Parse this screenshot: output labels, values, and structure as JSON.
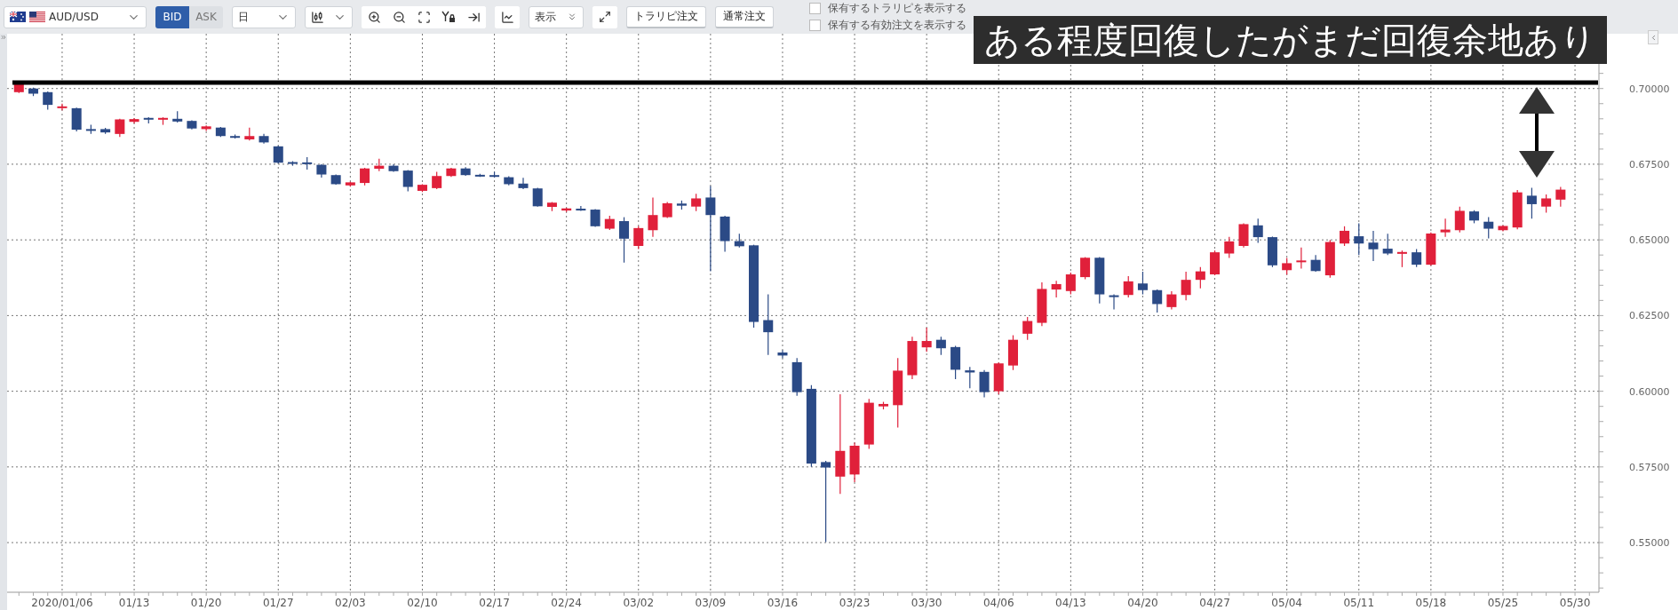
{
  "toolbar": {
    "symbol": {
      "label": "AUD/USD"
    },
    "price_side": [
      {
        "label": "BID",
        "selected": true
      },
      {
        "label": "ASK",
        "selected": false
      }
    ],
    "timeframe": {
      "value": "日"
    },
    "view_menu": {
      "label": "表示"
    },
    "order_buttons": [
      "トラリピ注文",
      "通常注文"
    ],
    "options": [
      {
        "label": "保有するトラリピを表示する",
        "checked": false
      },
      {
        "label": "保有する有効注文を表示する",
        "checked": false
      }
    ]
  },
  "chart": {
    "caption": "ある程度回復したがまだ回復余地あり",
    "chart_data": {
      "type": "candlestick",
      "categories": [
        null,
        null,
        null,
        "2020/01/06",
        null,
        null,
        null,
        null,
        "01/13",
        null,
        null,
        null,
        null,
        "01/20",
        null,
        null,
        null,
        null,
        "01/27",
        null,
        null,
        null,
        null,
        "02/03",
        null,
        null,
        null,
        null,
        "02/10",
        null,
        null,
        null,
        null,
        "02/17",
        null,
        null,
        null,
        null,
        "02/24",
        null,
        null,
        null,
        null,
        "03/02",
        null,
        null,
        null,
        null,
        "03/09",
        null,
        null,
        null,
        null,
        "03/16",
        null,
        null,
        null,
        null,
        "03/23",
        null,
        null,
        null,
        null,
        "03/30",
        null,
        null,
        null,
        null,
        "04/06",
        null,
        null,
        null,
        null,
        "04/13",
        null,
        null,
        null,
        null,
        "04/20",
        null,
        null,
        null,
        null,
        "04/27",
        null,
        null,
        null,
        null,
        "05/04",
        null,
        null,
        null,
        null,
        "05/11",
        null,
        null,
        null,
        null,
        "05/18",
        null,
        null,
        null,
        null,
        "05/25",
        null,
        null,
        null,
        null,
        "05/30"
      ],
      "ohlc": [
        [
          0.6988,
          0.702,
          0.6985,
          0.7015
        ],
        [
          0.7,
          0.7003,
          0.6975,
          0.6983
        ],
        [
          0.6988,
          0.699,
          0.693,
          0.6946
        ],
        [
          0.6937,
          0.695,
          0.6928,
          0.6941
        ],
        [
          0.6935,
          0.6937,
          0.6858,
          0.6864
        ],
        [
          0.6866,
          0.688,
          0.685,
          0.6862
        ],
        [
          0.6866,
          0.687,
          0.685,
          0.6855
        ],
        [
          0.685,
          0.69,
          0.684,
          0.6898
        ],
        [
          0.689,
          0.6902,
          0.6885,
          0.6899
        ],
        [
          0.6903,
          0.6905,
          0.6885,
          0.69
        ],
        [
          0.6897,
          0.6905,
          0.688,
          0.6903
        ],
        [
          0.69,
          0.6925,
          0.6888,
          0.6891
        ],
        [
          0.6893,
          0.6895,
          0.6865,
          0.6868
        ],
        [
          0.6866,
          0.6878,
          0.686,
          0.6875
        ],
        [
          0.6871,
          0.6873,
          0.684,
          0.6843
        ],
        [
          0.6843,
          0.6848,
          0.6835,
          0.684
        ],
        [
          0.6832,
          0.6871,
          0.6828,
          0.6843
        ],
        [
          0.6843,
          0.685,
          0.6818,
          0.6822
        ],
        [
          0.6809,
          0.6811,
          0.6753,
          0.6755
        ],
        [
          0.6757,
          0.676,
          0.6745,
          0.6755
        ],
        [
          0.6756,
          0.6773,
          0.6732,
          0.6751
        ],
        [
          0.6748,
          0.675,
          0.6706,
          0.6716
        ],
        [
          0.6714,
          0.6716,
          0.6682,
          0.6684
        ],
        [
          0.668,
          0.6692,
          0.6676,
          0.669
        ],
        [
          0.6688,
          0.6738,
          0.668,
          0.6736
        ],
        [
          0.6735,
          0.6768,
          0.6727,
          0.6745
        ],
        [
          0.6745,
          0.675,
          0.6725,
          0.6727
        ],
        [
          0.6729,
          0.6731,
          0.666,
          0.6675
        ],
        [
          0.6662,
          0.6684,
          0.6658,
          0.6682
        ],
        [
          0.6671,
          0.6725,
          0.6668,
          0.6711
        ],
        [
          0.6711,
          0.6738,
          0.6708,
          0.6736
        ],
        [
          0.6736,
          0.674,
          0.6712,
          0.6714
        ],
        [
          0.6715,
          0.6718,
          0.6708,
          0.6712
        ],
        [
          0.6714,
          0.6725,
          0.6706,
          0.6711
        ],
        [
          0.6707,
          0.671,
          0.668,
          0.6684
        ],
        [
          0.6686,
          0.6705,
          0.6668,
          0.6671
        ],
        [
          0.667,
          0.6672,
          0.661,
          0.6611
        ],
        [
          0.6609,
          0.6625,
          0.6595,
          0.6623
        ],
        [
          0.6597,
          0.6606,
          0.6592,
          0.6604
        ],
        [
          0.6603,
          0.6612,
          0.6596,
          0.6598
        ],
        [
          0.66,
          0.6602,
          0.6543,
          0.6545
        ],
        [
          0.6537,
          0.658,
          0.6533,
          0.6569
        ],
        [
          0.6562,
          0.6575,
          0.6425,
          0.6504
        ],
        [
          0.648,
          0.6545,
          0.647,
          0.6539
        ],
        [
          0.6532,
          0.664,
          0.651,
          0.6582
        ],
        [
          0.6575,
          0.6625,
          0.6572,
          0.6621
        ],
        [
          0.662,
          0.663,
          0.66,
          0.6613
        ],
        [
          0.661,
          0.6652,
          0.6595,
          0.6637
        ],
        [
          0.664,
          0.6678,
          0.6396,
          0.6582
        ],
        [
          0.6577,
          0.658,
          0.6461,
          0.6496
        ],
        [
          0.6496,
          0.652,
          0.6475,
          0.6479
        ],
        [
          0.6482,
          0.6484,
          0.621,
          0.6229
        ],
        [
          0.6235,
          0.632,
          0.612,
          0.6195
        ],
        [
          0.6128,
          0.6135,
          0.611,
          0.6118
        ],
        [
          0.6096,
          0.611,
          0.5985,
          0.5997
        ],
        [
          0.6008,
          0.602,
          0.575,
          0.5761
        ],
        [
          0.5766,
          0.577,
          0.5502,
          0.5748
        ],
        [
          0.5718,
          0.599,
          0.5661,
          0.5803
        ],
        [
          0.5725,
          0.583,
          0.57,
          0.582
        ],
        [
          0.5824,
          0.5975,
          0.581,
          0.5962
        ],
        [
          0.595,
          0.5965,
          0.594,
          0.5958
        ],
        [
          0.5954,
          0.611,
          0.588,
          0.6068
        ],
        [
          0.6053,
          0.618,
          0.604,
          0.6166
        ],
        [
          0.6145,
          0.621,
          0.613,
          0.6166
        ],
        [
          0.617,
          0.618,
          0.612,
          0.6142
        ],
        [
          0.6146,
          0.615,
          0.604,
          0.6071
        ],
        [
          0.6069,
          0.608,
          0.601,
          0.6062
        ],
        [
          0.6064,
          0.607,
          0.598,
          0.5997
        ],
        [
          0.6,
          0.6095,
          0.599,
          0.6092
        ],
        [
          0.6085,
          0.6185,
          0.607,
          0.617
        ],
        [
          0.619,
          0.6245,
          0.617,
          0.6232
        ],
        [
          0.6226,
          0.636,
          0.6215,
          0.6338
        ],
        [
          0.6336,
          0.6365,
          0.631,
          0.6354
        ],
        [
          0.6331,
          0.6392,
          0.632,
          0.6386
        ],
        [
          0.6377,
          0.6443,
          0.637,
          0.6441
        ],
        [
          0.6441,
          0.6443,
          0.629,
          0.632
        ],
        [
          0.6317,
          0.632,
          0.627,
          0.6311
        ],
        [
          0.6318,
          0.638,
          0.631,
          0.6363
        ],
        [
          0.6356,
          0.6395,
          0.632,
          0.6334
        ],
        [
          0.6334,
          0.6336,
          0.626,
          0.6288
        ],
        [
          0.6278,
          0.633,
          0.627,
          0.632
        ],
        [
          0.6318,
          0.6395,
          0.63,
          0.6368
        ],
        [
          0.6368,
          0.641,
          0.634,
          0.6396
        ],
        [
          0.6386,
          0.6465,
          0.6383,
          0.6459
        ],
        [
          0.6455,
          0.651,
          0.644,
          0.6495
        ],
        [
          0.648,
          0.6555,
          0.6475,
          0.6552
        ],
        [
          0.6548,
          0.657,
          0.649,
          0.6509
        ],
        [
          0.6509,
          0.6511,
          0.641,
          0.6416
        ],
        [
          0.64,
          0.644,
          0.6385,
          0.6423
        ],
        [
          0.6427,
          0.6475,
          0.6405,
          0.6432
        ],
        [
          0.6434,
          0.645,
          0.6395,
          0.6397
        ],
        [
          0.6383,
          0.65,
          0.6375,
          0.6493
        ],
        [
          0.6488,
          0.6545,
          0.648,
          0.653
        ],
        [
          0.6512,
          0.6555,
          0.645,
          0.6488
        ],
        [
          0.6491,
          0.653,
          0.643,
          0.6469
        ],
        [
          0.6471,
          0.652,
          0.645,
          0.6455
        ],
        [
          0.6454,
          0.6465,
          0.641,
          0.646
        ],
        [
          0.6459,
          0.647,
          0.641,
          0.6418
        ],
        [
          0.6418,
          0.6525,
          0.6415,
          0.6521
        ],
        [
          0.6525,
          0.657,
          0.651,
          0.6534
        ],
        [
          0.6532,
          0.661,
          0.6525,
          0.6596
        ],
        [
          0.6594,
          0.6598,
          0.6555,
          0.6564
        ],
        [
          0.656,
          0.6575,
          0.6505,
          0.6537
        ],
        [
          0.6532,
          0.6548,
          0.6528,
          0.6546
        ],
        [
          0.6541,
          0.6665,
          0.6535,
          0.6657
        ],
        [
          0.6646,
          0.6672,
          0.657,
          0.6618
        ],
        [
          0.661,
          0.665,
          0.659,
          0.6637
        ],
        [
          0.6633,
          0.6675,
          0.661,
          0.6666
        ],
        null
      ],
      "ylim": [
        0.5336,
        0.7181
      ],
      "grid": true,
      "ref_lines": [
        {
          "axis": "y",
          "value": 0.702
        }
      ],
      "yticks": [
        {
          "value": 0.55,
          "label": "0.55000"
        },
        {
          "value": 0.575,
          "label": "0.57500"
        },
        {
          "value": 0.6,
          "label": "0.60000"
        },
        {
          "value": 0.625,
          "label": "0.62500"
        },
        {
          "value": 0.65,
          "label": "0.65000"
        },
        {
          "value": 0.675,
          "label": "0.67500"
        },
        {
          "value": 0.7,
          "label": "0.70000"
        }
      ]
    }
  }
}
